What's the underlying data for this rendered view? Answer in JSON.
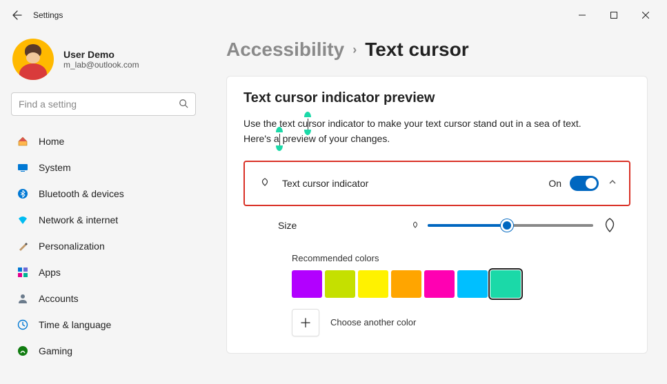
{
  "window": {
    "app_title": "Settings"
  },
  "user": {
    "name": "User Demo",
    "email": "m_lab@outlook.com"
  },
  "search": {
    "placeholder": "Find a setting"
  },
  "nav": {
    "items": [
      {
        "label": "Home",
        "icon": "home-icon"
      },
      {
        "label": "System",
        "icon": "system-icon"
      },
      {
        "label": "Bluetooth & devices",
        "icon": "bluetooth-icon"
      },
      {
        "label": "Network & internet",
        "icon": "network-icon"
      },
      {
        "label": "Personalization",
        "icon": "personalization-icon"
      },
      {
        "label": "Apps",
        "icon": "apps-icon"
      },
      {
        "label": "Accounts",
        "icon": "accounts-icon"
      },
      {
        "label": "Time & language",
        "icon": "time-language-icon"
      },
      {
        "label": "Gaming",
        "icon": "gaming-icon"
      }
    ]
  },
  "breadcrumb": {
    "parent": "Accessibility",
    "current": "Text cursor"
  },
  "preview": {
    "heading": "Text cursor indicator preview",
    "text_before": "Use the text cu",
    "text_mid": "rsor indicator to make your text cursor stand out in a sea of text. Here's a",
    "text_after": " preview of your changes."
  },
  "indicator_row": {
    "label": "Text cursor indicator",
    "state_label": "On",
    "state": true
  },
  "size_row": {
    "label": "Size",
    "value_percent": 48
  },
  "colors": {
    "heading": "Recommended colors",
    "swatches": [
      "#b200ff",
      "#c5e000",
      "#fff200",
      "#ffa500",
      "#ff00b2",
      "#00bfff",
      "#1bd9a8"
    ],
    "selected_index": 6,
    "choose_label": "Choose another color"
  }
}
